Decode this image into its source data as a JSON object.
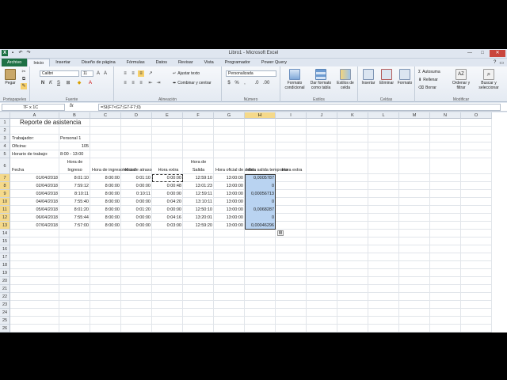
{
  "window": {
    "title": "Libro1 - Microsoft Excel"
  },
  "tabs": [
    "Archivo",
    "Inicio",
    "Insertar",
    "Diseño de página",
    "Fórmulas",
    "Datos",
    "Revisar",
    "Vista",
    "Programador",
    "Power Query"
  ],
  "ribbon": {
    "clipboard": {
      "paste": "Pegar",
      "label": "Portapapeles"
    },
    "font": {
      "name": "Calibri",
      "size": "11",
      "label": "Fuente"
    },
    "alignment": {
      "wrap": "Ajustar texto",
      "merge": "Combinar y centrar",
      "label": "Alineación"
    },
    "number": {
      "format": "Personalizada",
      "label": "Número"
    },
    "styles": {
      "cond": "Formato condicional",
      "table": "Dar formato como tabla",
      "cell": "Estilos de celda",
      "label": "Estilos"
    },
    "cells": {
      "insert": "Insertar",
      "delete": "Eliminar",
      "format": "Formato",
      "label": "Celdas"
    },
    "editing": {
      "autosum": "Autosuma",
      "fill": "Rellenar",
      "clear": "Borrar",
      "sort": "Ordenar y filtrar",
      "find": "Buscar y seleccionar",
      "label": "Modificar"
    }
  },
  "formula_bar": {
    "name_box": "7F x 1C",
    "fx": "fx",
    "formula": "=SI(F7<G7;G7-F7;0)"
  },
  "columns": [
    "A",
    "B",
    "C",
    "D",
    "E",
    "F",
    "G",
    "H",
    "I",
    "J",
    "K",
    "L",
    "M",
    "N",
    "O"
  ],
  "rows": [
    "1",
    "2",
    "3",
    "4",
    "5",
    "6",
    "7",
    "8",
    "9",
    "10",
    "11",
    "12",
    "13",
    "14",
    "15",
    "16",
    "17",
    "18",
    "19",
    "20",
    "21",
    "22",
    "23",
    "24",
    "25",
    "26"
  ],
  "sheet": {
    "title": "Reporte de asistencia",
    "info": [
      {
        "label": "Trabajador:",
        "value": "Personal 1"
      },
      {
        "label": "Oficina:",
        "value": "105"
      },
      {
        "label": "Horario de trabajo:",
        "value": "8:00 - 13:00"
      }
    ],
    "headers": {
      "fecha": "Fecha",
      "hora_ingreso": [
        "Hora de",
        "Ingreso"
      ],
      "hora_ingreso_oficial": "Hora de ingreso oficial",
      "hora_atraso": "Hora de atraso",
      "hora_extra": "Hora extra",
      "hora_salida": [
        "Hora de",
        "Salida"
      ],
      "hora_oficial_salida": "Hora oficial de salida",
      "hora_salida_temprana": "Hora salida temprana",
      "hora_extra2": "Hora extra"
    },
    "data": [
      [
        "01/04/2018",
        "8:01:10",
        "8:00:00",
        "0:01:10",
        "0:00:00",
        "12:59:10",
        "13:00:00",
        "0,0005787"
      ],
      [
        "02/04/2018",
        "7:59:12",
        "8:00:00",
        "0:00:00",
        "0:00:48",
        "13:01:23",
        "13:00:00",
        "0"
      ],
      [
        "03/04/2018",
        "8:10:11",
        "8:00:00",
        "0:10:11",
        "0:00:00",
        "12:59:11",
        "13:00:00",
        "0,00056713"
      ],
      [
        "04/04/2018",
        "7:55:40",
        "8:00:00",
        "0:00:00",
        "0:04:20",
        "13:10:11",
        "13:00:00",
        "0"
      ],
      [
        "05/04/2018",
        "8:01:20",
        "8:00:00",
        "0:01:20",
        "0:00:00",
        "12:50:10",
        "13:00:00",
        "0,0068287"
      ],
      [
        "06/04/2018",
        "7:55:44",
        "8:00:00",
        "0:00:00",
        "0:04:16",
        "13:20:01",
        "13:00:00",
        "0"
      ],
      [
        "07/04/2018",
        "7:57:00",
        "8:00:00",
        "0:00:00",
        "0:03:00",
        "12:59:20",
        "13:00:00",
        "0,00046296"
      ]
    ]
  }
}
